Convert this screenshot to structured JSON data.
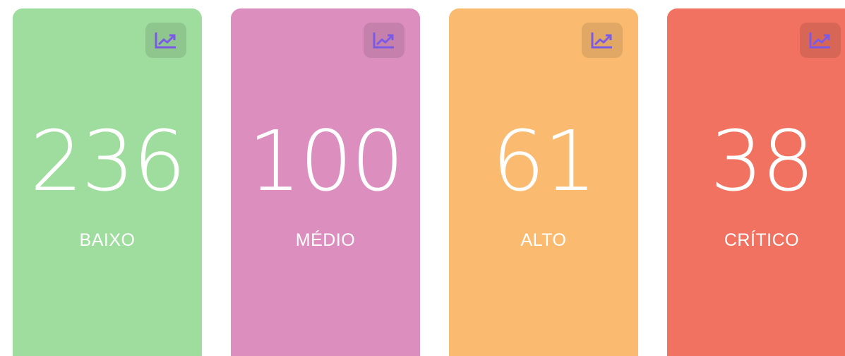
{
  "cards": [
    {
      "label": "BAIXO",
      "count": "236",
      "color": "#9fdd9f",
      "icon": "trending-up-icon"
    },
    {
      "label": "MÉDIO",
      "count": "100",
      "color": "#dc8fbf",
      "icon": "trending-up-icon"
    },
    {
      "label": "ALTO",
      "count": "61",
      "color": "#fabb70",
      "icon": "trending-up-icon"
    },
    {
      "label": "CRÍTICO",
      "count": "38",
      "color": "#f17260",
      "icon": "trending-up-icon"
    }
  ],
  "colors": {
    "icon_stroke": "#7b5be6",
    "text": "#ffffff"
  }
}
